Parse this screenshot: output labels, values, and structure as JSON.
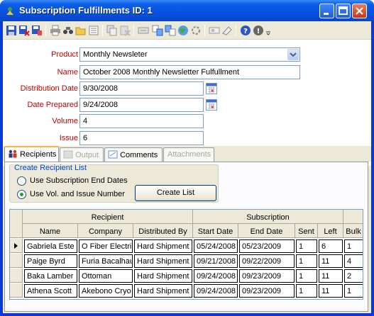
{
  "window": {
    "title": "Subscription Fulfillments ID: 1"
  },
  "toolbar": {
    "icons": [
      "save-icon",
      "save-close-icon",
      "save-new-icon",
      "print-icon",
      "find-icon",
      "open-folder-icon",
      "list-icon",
      "copy-icon",
      "delete-icon",
      "properties-icon",
      "export-icon",
      "import-icon",
      "globe-icon",
      "refresh-icon",
      "clipboard-icon",
      "eraser-icon",
      "help-icon",
      "info-icon",
      "more-icon"
    ]
  },
  "form": {
    "product_label": "Product",
    "product_value": "Monthly Newsleter",
    "name_label": "Name",
    "name_value": "October 2008 Monthly Newsletter Fulfullment",
    "distribution_date_label": "Distribution Date",
    "distribution_date_value": "9/30/2008",
    "date_prepared_label": "Date Prepared",
    "date_prepared_value": "9/24/2008",
    "volume_label": "Volume",
    "volume_value": "4",
    "issue_label": "Issue",
    "issue_value": "6"
  },
  "tabs": [
    {
      "label": "Recipients",
      "active": true,
      "enabled": true
    },
    {
      "label": "Output",
      "active": false,
      "enabled": false
    },
    {
      "label": "Comments",
      "active": false,
      "enabled": true
    },
    {
      "label": "Attachments",
      "active": false,
      "enabled": false
    }
  ],
  "recipients": {
    "group_title": "Create Recipient List",
    "option1_label": "Use Subscription End Dates",
    "option2_label": "Use Vol. and Issue Number",
    "selected_option": 2,
    "create_button_label": "Create List"
  },
  "grid": {
    "group_headers": [
      "Recipient",
      "Subscription"
    ],
    "columns": [
      "Name",
      "Company",
      "Distributed By",
      "Start Date",
      "End Date",
      "Sent",
      "Left",
      "Bulk"
    ],
    "rows": [
      [
        "Gabriela Este",
        "O Fiber Electri",
        "Hard Shipment",
        "05/24/2008",
        "05/23/2009",
        "1",
        "6",
        "1"
      ],
      [
        "Paige Byrd",
        "Furia Bacalhau",
        "Hard Shipment",
        "09/21/2008",
        "09/22/2009",
        "1",
        "11",
        "4"
      ],
      [
        "Baka Lamber",
        "Ottoman",
        "Hard Shipment",
        "09/24/2008",
        "09/23/2009",
        "1",
        "11",
        "2"
      ],
      [
        "Athena Scott",
        "Akebono Cryo",
        "Hard Shipment",
        "09/24/2008",
        "09/23/2009",
        "1",
        "11",
        "1"
      ]
    ],
    "current_row": 0
  }
}
